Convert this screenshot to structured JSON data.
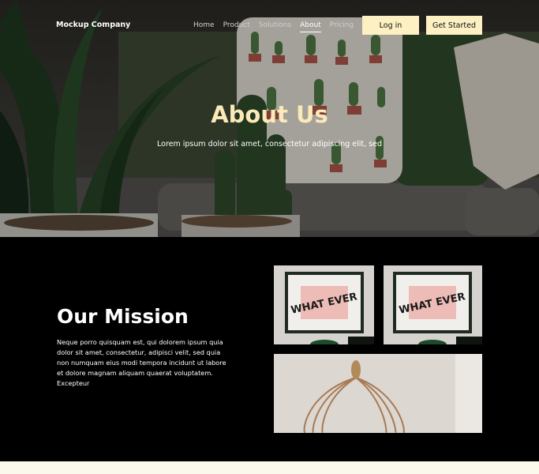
{
  "brand": "Mockup Company",
  "nav": {
    "links": [
      "Home",
      "Product",
      "Solutions",
      "About",
      "Pricing"
    ],
    "active": "About",
    "login_label": "Log in",
    "get_started_label": "Get Started"
  },
  "hero": {
    "title": "About Us",
    "subtitle": "Lorem ipsum dolor sit amet, consectetur adipiscing elit, sed"
  },
  "mission": {
    "title": "Our Mission",
    "text": "Neque porro quisquam est, qui dolorem ipsum quia dolor sit amet, consectetur, adipisci velit, sed quia non numquam eius modi tempora incidunt ut labore et dolore magnam aliquam quaerat voluptatem. Excepteur"
  },
  "artwork_text": "WHAT EVER",
  "colors": {
    "accent": "#fdf0c2",
    "hero_title": "#fbe9b8",
    "section_bg": "#000000",
    "footer_bg": "#fbf8ec"
  }
}
